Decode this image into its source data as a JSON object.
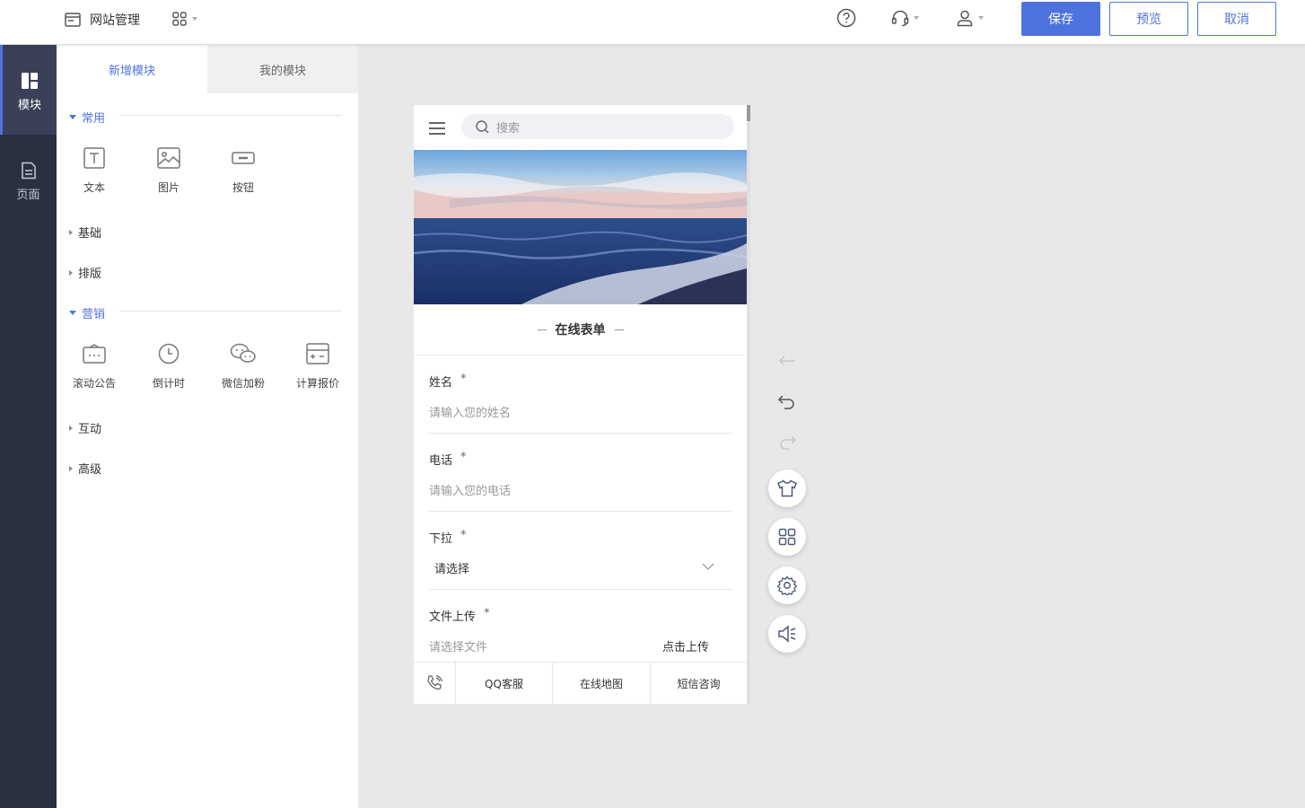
{
  "topbar": {
    "site_label": "网站管理",
    "save_label": "保存",
    "preview_label": "预览",
    "cancel_label": "取消"
  },
  "rail": {
    "items": [
      {
        "label": "模块",
        "icon": "module-icon",
        "active": true
      },
      {
        "label": "页面",
        "icon": "page-icon",
        "active": false
      }
    ]
  },
  "panel": {
    "tabs": [
      {
        "label": "新增模块",
        "active": true
      },
      {
        "label": "我的模块",
        "active": false
      }
    ],
    "sections": {
      "common": "常用",
      "basic": "基础",
      "layout": "排版",
      "marketing": "营销",
      "interactive": "互动",
      "advanced": "高级"
    },
    "common_modules": [
      {
        "label": "文本",
        "icon": "text-icon"
      },
      {
        "label": "图片",
        "icon": "image-icon"
      },
      {
        "label": "按钮",
        "icon": "button-icon"
      }
    ],
    "marketing_modules": [
      {
        "label": "滚动公告",
        "icon": "scroll-notice-icon"
      },
      {
        "label": "倒计时",
        "icon": "countdown-icon"
      },
      {
        "label": "微信加粉",
        "icon": "wechat-icon"
      },
      {
        "label": "计算报价",
        "icon": "calculator-icon"
      }
    ]
  },
  "phone": {
    "search_placeholder": "搜索",
    "form_title": "在线表单",
    "fields": [
      {
        "label": "姓名",
        "required": "*",
        "placeholder": "请输入您的姓名"
      },
      {
        "label": "电话",
        "required": "*",
        "placeholder": "请输入您的电话"
      },
      {
        "label": "下拉",
        "required": "*",
        "placeholder": "请选择"
      },
      {
        "label": "文件上传",
        "required": "*",
        "placeholder": "请选择文件",
        "action": "点击上传"
      }
    ],
    "bottom_bar": [
      "QQ客服",
      "在线地图",
      "短信咨询"
    ]
  },
  "colors": {
    "accent": "#4f73de",
    "rail_bg": "#2b3040",
    "canvas_bg": "#e8e8e8"
  }
}
